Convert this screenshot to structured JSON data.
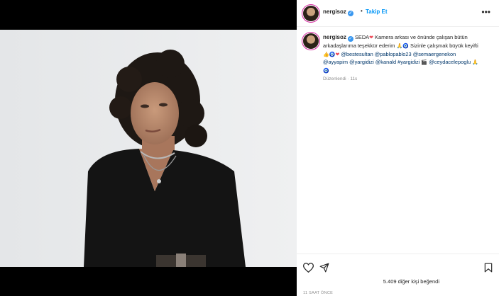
{
  "post": {
    "username": "nergisoz",
    "follow_label": "Takip Et",
    "more_icon": "ellipsis-icon",
    "caption": {
      "name_tag": "SEDA",
      "line1": "Kamera arkası ve önünde çalışan bütün",
      "line2": "arkadaşlarıma teşekkür ederim",
      "line2b": "Sizinle çalışmak büyük keyifti",
      "mentions": [
        "@bestesultan",
        "@pablopablo23",
        "@semaergenekon",
        "@ayyapim",
        "@yargidizi",
        "@kanald",
        "#yargidizi",
        "@ceydacelepoglu"
      ]
    },
    "edited": "Düzenlendi",
    "edited_time": "11s",
    "likes_text": "5.409 diğer kişi beğendi",
    "posted_time": "11 SAAT ÖNCE"
  },
  "icons": [
    "heart-icon",
    "share-icon",
    "bookmark-icon",
    "verified-icon"
  ],
  "colors": {
    "link": "#0095f6",
    "mention": "#00376b",
    "verified": "#3897f0",
    "heart": "#ed4956"
  }
}
